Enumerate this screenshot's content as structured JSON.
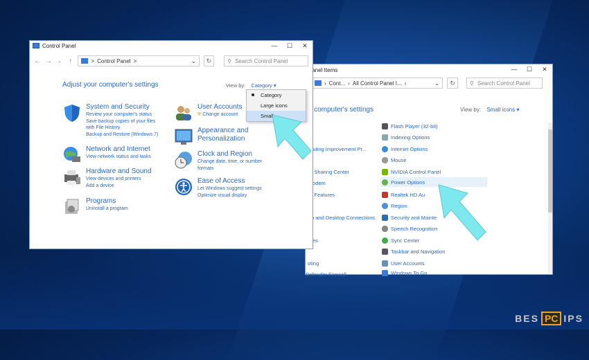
{
  "brand": {
    "left": "BES",
    "pc": "PC",
    "right": "IPS"
  },
  "win1": {
    "title": "Control Panel",
    "address": "Control Panel",
    "address_sep": ">",
    "search_placeholder": "Search Control Panel",
    "heading": "Adjust your computer's settings",
    "viewby_label": "View by:",
    "viewby_value": "Category",
    "menu": [
      "Category",
      "Large icons",
      "Small icons"
    ],
    "menu_visible_small": "Small",
    "categories": [
      {
        "title": "System and Security",
        "links": [
          "Review your computer's status",
          "Save backup copies of your files",
          "with File History",
          "Backup and Restore (Windows 7)"
        ]
      },
      {
        "title": "Network and Internet",
        "links": [
          "View network status and tasks"
        ]
      },
      {
        "title": "Hardware and Sound",
        "links": [
          "View devices and printers",
          "Add a device"
        ]
      },
      {
        "title": "Programs",
        "links": [
          "Uninstall a program"
        ]
      },
      {
        "title": "User Accounts",
        "links": [
          "Change account"
        ]
      },
      {
        "title": "Appearance and",
        "title2": "Personalization",
        "links": []
      },
      {
        "title": "Clock and Region",
        "links": [
          "Change date, time, or number",
          "formats"
        ]
      },
      {
        "title": "Ease of Access",
        "links": [
          "Let Windows suggest settings",
          "Optimize visual display"
        ]
      }
    ]
  },
  "win2": {
    "title": "Panel Items",
    "address": [
      "Cont...",
      "All Control Panel I..."
    ],
    "search_placeholder": "Search Control Panel",
    "heading": "r computer's settings",
    "viewby_label": "View by:",
    "viewby_value": "Small icons",
    "left_items": [
      "mputing Improvement Pr...",
      "nd Sharing Center",
      "l Modem",
      "nd Features",
      "p and Desktop Connections",
      "aces",
      "oting",
      "Defender Firewall"
    ],
    "right_items": [
      "Flash Player (32-bit)",
      "Indexing Options",
      "Internet Options",
      "Mouse",
      "NVIDIA Control Panel",
      "Power Options",
      "Realtek HD Au",
      "Region",
      "Security and Mainte",
      "Speech Recognition",
      "Sync Center",
      "Taskbar and Navigation",
      "User Accounts",
      "Windows To Go"
    ],
    "colors": {
      "accent": "#2a6ab8",
      "highlight": "#e5f1fb",
      "arrow": "#7ee8ef"
    }
  }
}
